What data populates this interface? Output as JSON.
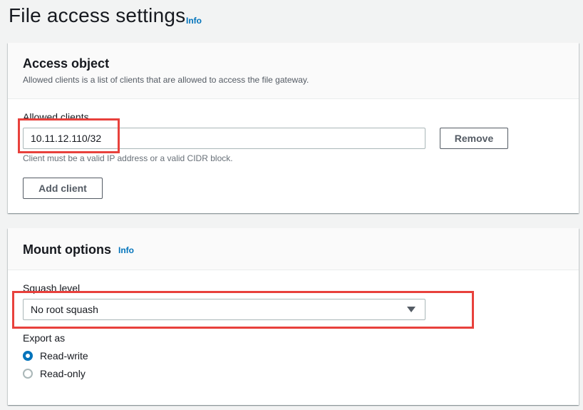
{
  "page": {
    "title": "File access settings",
    "info_label": "Info"
  },
  "access_object": {
    "title": "Access object",
    "description": "Allowed clients is a list of clients that are allowed to access the file gateway.",
    "allowed_clients_label": "Allowed clients",
    "client_value": "10.11.12.110/32",
    "hint": "Client must be a valid IP address or a valid CIDR block.",
    "remove_label": "Remove",
    "add_client_label": "Add client"
  },
  "mount_options": {
    "title": "Mount options",
    "info_label": "Info",
    "squash_label": "Squash level",
    "squash_value": "No root squash",
    "export_label": "Export as",
    "export_options": [
      {
        "label": "Read-write",
        "selected": true
      },
      {
        "label": "Read-only",
        "selected": false
      }
    ]
  },
  "colors": {
    "accent": "#0073bb",
    "highlight": "#e8413c"
  }
}
